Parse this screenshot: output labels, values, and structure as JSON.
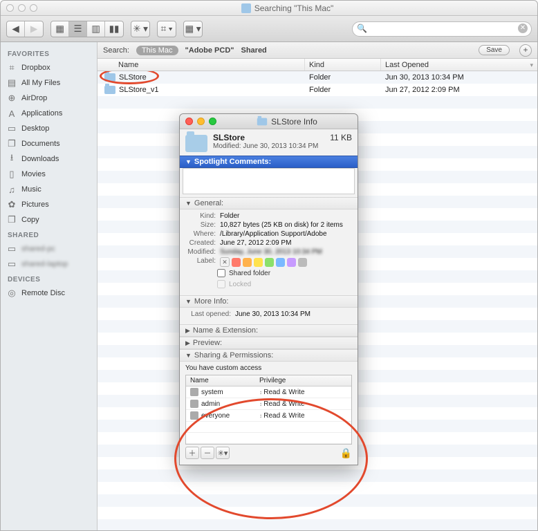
{
  "window": {
    "title": "Searching \"This Mac\""
  },
  "toolbar": {
    "search_placeholder": ""
  },
  "sidebar": {
    "favorites_header": "FAVORITES",
    "shared_header": "SHARED",
    "devices_header": "DEVICES",
    "favorites": [
      {
        "icon": "dropbox-icon",
        "glyph": "⌗",
        "label": "Dropbox"
      },
      {
        "icon": "all-files-icon",
        "glyph": "▤",
        "label": "All My Files"
      },
      {
        "icon": "airdrop-icon",
        "glyph": "⊕",
        "label": "AirDrop"
      },
      {
        "icon": "applications-icon",
        "glyph": "A",
        "label": "Applications"
      },
      {
        "icon": "desktop-icon",
        "glyph": "▭",
        "label": "Desktop"
      },
      {
        "icon": "documents-icon",
        "glyph": "❐",
        "label": "Documents"
      },
      {
        "icon": "downloads-icon",
        "glyph": "⭳",
        "label": "Downloads"
      },
      {
        "icon": "movies-icon",
        "glyph": "▯",
        "label": "Movies"
      },
      {
        "icon": "music-icon",
        "glyph": "♫",
        "label": "Music"
      },
      {
        "icon": "pictures-icon",
        "glyph": "✿",
        "label": "Pictures"
      },
      {
        "icon": "copy-icon",
        "glyph": "❐",
        "label": "Copy"
      }
    ],
    "shared": [
      {
        "icon": "pc-icon",
        "glyph": "▭",
        "label": "shared-pc"
      },
      {
        "icon": "pc-icon",
        "glyph": "▭",
        "label": "shared-laptop"
      }
    ],
    "devices": [
      {
        "icon": "disc-icon",
        "glyph": "◎",
        "label": "Remote Disc"
      }
    ]
  },
  "searchbar": {
    "label": "Search:",
    "scope1": "This Mac",
    "scope2": "\"Adobe PCD\"",
    "scope3": "Shared",
    "save": "Save"
  },
  "columns": {
    "name": "Name",
    "kind": "Kind",
    "opened": "Last Opened"
  },
  "results": [
    {
      "name": "SLStore",
      "kind": "Folder",
      "opened": "Jun 30, 2013 10:34 PM"
    },
    {
      "name": "SLStore_v1",
      "kind": "Folder",
      "opened": "Jun 27, 2012 2:09 PM"
    }
  ],
  "info": {
    "title": "SLStore Info",
    "name": "SLStore",
    "size": "11 KB",
    "modified_header": "Modified: June 30, 2013 10:34 PM",
    "sections": {
      "spotlight": "Spotlight Comments:",
      "general": "General:",
      "moreinfo": "More Info:",
      "nameext": "Name & Extension:",
      "preview": "Preview:",
      "sharing": "Sharing & Permissions:"
    },
    "general": {
      "kind_k": "Kind:",
      "kind_v": "Folder",
      "size_k": "Size:",
      "size_v": "10,827 bytes (25 KB on disk) for 2 items",
      "where_k": "Where:",
      "where_v": "/Library/Application Support/Adobe",
      "created_k": "Created:",
      "created_v": "June 27, 2012 2:09 PM",
      "modified_k": "Modified:",
      "modified_v": "Sunday, June 30, 2013 10:34 PM",
      "label_k": "Label:",
      "shared_chk": "Shared folder",
      "locked_chk": "Locked"
    },
    "moreinfo": {
      "lastopened_k": "Last opened:",
      "lastopened_v": "June 30, 2013 10:34 PM"
    },
    "sharing": {
      "access_text": "You have custom access",
      "head_name": "Name",
      "head_priv": "Privilege",
      "rows": [
        {
          "name": "system",
          "priv": "Read & Write"
        },
        {
          "name": "admin",
          "priv": "Read & Write"
        },
        {
          "name": "everyone",
          "priv": "Read & Write"
        }
      ]
    }
  }
}
